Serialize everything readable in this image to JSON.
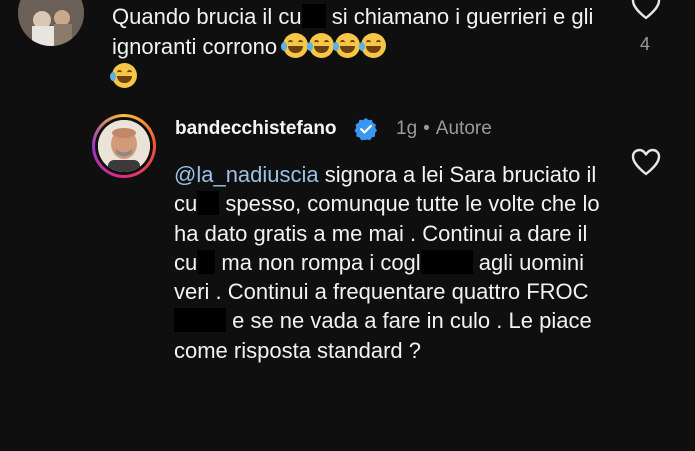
{
  "top_comment": {
    "text_1": "Quando brucia il cu",
    "text_2": "si chiamano i guerrieri e gli ignoranti corrono",
    "like_count": "4",
    "emoji": "face-with-tears-of-joy",
    "emoji_count": 5
  },
  "reply": {
    "username": "bandecchistefano",
    "time": "1g",
    "separator": "•",
    "role": "Autore",
    "mention": "@la_nadiuscia",
    "segments": [
      " signora a lei Sara bruciato il cu",
      " spesso, comunque tutte le volte che lo ha dato gratis a me mai . Continui a dare il cu",
      " ma non rompa i cogl",
      " agli uomini veri . Continui a frequentare quattro FROC",
      " e se ne vada a fare in culo . Le piace come risposta standard ?"
    ]
  },
  "icons": {
    "heart": "heart-outline-icon",
    "verified": "verified-badge-icon"
  },
  "colors": {
    "background": "#0f0f10",
    "text": "#f2f2f2",
    "muted": "#9a9a9a",
    "mention": "#9bc1e6",
    "verified": "#3897f0"
  }
}
